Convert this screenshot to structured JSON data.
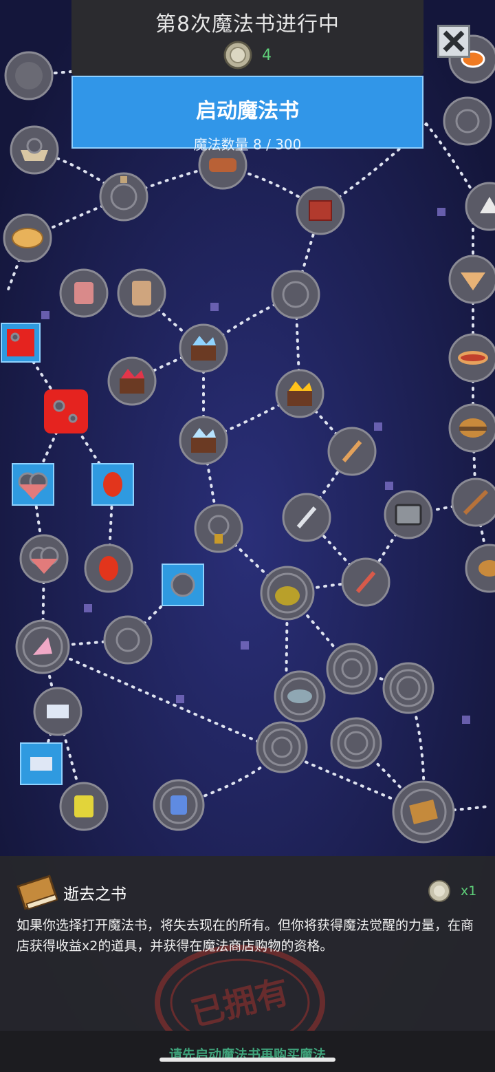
{
  "header": {
    "title": "第8次魔法书进行中",
    "coins": "4"
  },
  "start_button": {
    "label": "启动魔法书",
    "magic_count": "魔法数量 8 / 300"
  },
  "detail": {
    "item_name": "逝去之书",
    "cost": "x1",
    "description": "如果你选择打开魔法书，将失去现在的所有。但你将获得魔法觉醒的力量，在商店获得收益x2的道具，并获得在魔法商店购物的资格。",
    "stamp_text": "已拥有"
  },
  "footer": {
    "buy_hint": "请先启动魔法书再购买魔法"
  },
  "colors": {
    "background": "#14163b",
    "accent_blue": "#3196e8",
    "coin_green": "#5fd17a",
    "hint_green": "#3fa27a",
    "highlight_pink": "#c8365f"
  }
}
